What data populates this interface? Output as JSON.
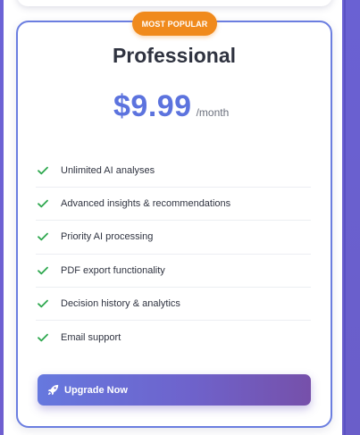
{
  "badge": {
    "label": "MOST POPULAR"
  },
  "plan": {
    "name": "Professional",
    "price": "$9.99",
    "period": "/month"
  },
  "features": [
    {
      "icon": "check-icon",
      "label": "Unlimited AI analyses"
    },
    {
      "icon": "check-icon",
      "label": "Advanced insights & recommendations"
    },
    {
      "icon": "check-icon",
      "label": "Priority AI processing"
    },
    {
      "icon": "check-icon",
      "label": "PDF export functionality"
    },
    {
      "icon": "check-icon",
      "label": "Decision history & analytics"
    },
    {
      "icon": "check-icon",
      "label": "Email support"
    }
  ],
  "cta": {
    "icon": "rocket-icon",
    "label": "Upgrade Now"
  },
  "colors": {
    "accent": "#5c73de",
    "badge": "#f08a1c",
    "check": "#2fa84f",
    "card_border": "#6b7ee0",
    "button_start": "#6678de",
    "button_end": "#7650aa"
  }
}
